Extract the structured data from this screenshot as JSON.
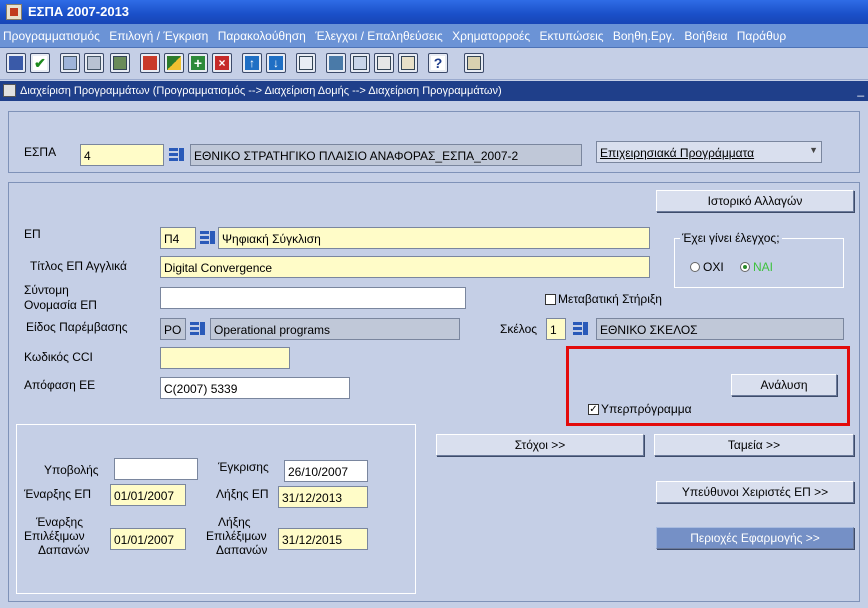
{
  "window": {
    "title": "ΕΣΠΑ 2007-2013"
  },
  "menu": [
    "Προγραμματισμός",
    "Επιλογή / Έγκριση",
    "Παρακολούθηση",
    "Έλεγχοι / Επαληθεύσεις",
    "Χρηματορροές",
    "Εκτυπώσεις",
    "Βοηθη.Εργ.",
    "Βοήθεια",
    "Παράθυρ"
  ],
  "toolbar": {
    "icons": [
      "save-icon",
      "accept-icon",
      "copy-record-icon",
      "clear-record-icon",
      "duplicate-icon",
      "clear-icon",
      "pen-icon",
      "insert-record-icon",
      "delete-record-icon",
      "prev-record-icon",
      "next-record-icon",
      "list-icon",
      "query-icon",
      "enter-query-icon",
      "execute-query-icon",
      "print-icon",
      "help-icon",
      "exit-icon"
    ]
  },
  "subwindow": {
    "title": "Διαχείριση Προγραμμάτων (Προγραμματισμός --> Διαχείριση Δομής --> Διαχείριση Προγραμμάτων)"
  },
  "header": {
    "espa_label": "ΕΣΠΑ",
    "espa_code": "4",
    "espa_name": "ΕΘΝΙΚΟ ΣΤΡΑΤΗΓΙΚΟ ΠΛΑΙΣΙΟ ΑΝΑΦΟΡΑΣ_ΕΣΠΑ_2007-2",
    "program_type_selected": "Επιχειρησιακά Προγράμματα"
  },
  "form": {
    "history_button": "Ιστορικό Αλλαγών",
    "ep_label": "ΕΠ",
    "ep_code": "Π4",
    "ep_name": "Ψηφιακή Σύγκλιση",
    "title_en_label": "Τίτλος ΕΠ Αγγλικά",
    "title_en_value": "Digital Convergence",
    "short_name_label_1": "Σύντομη",
    "short_name_label_2": "Ονομασία ΕΠ",
    "short_name_value": "",
    "checked_group_label": "Έχει γίνει έλεγχος;",
    "radio_no": "ΟΧΙ",
    "radio_yes": "ΝΑΙ",
    "transitional_label": "Μεταβατική Στήριξη",
    "intervention_label": "Είδος Παρέμβασης",
    "intervention_code": "PO",
    "intervention_name": "Operational programs",
    "skelos_label": "Σκέλος",
    "skelos_code": "1",
    "skelos_name": "ΕΘΝΙΚΟ ΣΚΕΛΟΣ",
    "cci_label": "Κωδικός CCI",
    "cci_value": "",
    "decision_label": "Απόφαση ΕΕ",
    "decision_value": "C(2007) 5339",
    "subprogram_label": "Υπερπρόγραμμα",
    "analysis_button": "Ανάλυση",
    "goals_button": "Στόχοι >>",
    "funds_button": "Ταμεία >>",
    "managers_button": "Υπεύθυνοι Χειριστές ΕΠ >>",
    "regions_button": "Περιοχές Εφαρμογής >>"
  },
  "dates": {
    "submission_label": "Υποβολής",
    "submission_value": "",
    "approval_label": "Έγκρισης",
    "approval_value": "26/10/2007",
    "start_label": "Έναρξης ΕΠ",
    "start_value": "01/01/2007",
    "end_label": "Λήξης ΕΠ",
    "end_value": "31/12/2013",
    "elig_start_label_1": "Έναρξης",
    "elig_start_label_2": "Επιλέξιμων",
    "elig_start_label_3": "Δαπανών",
    "elig_start_value": "01/01/2007",
    "elig_end_label_1": "Λήξης",
    "elig_end_label_2": "Επιλέξιμων",
    "elig_end_label_3": "Δαπανών",
    "elig_end_value": "31/12/2015"
  },
  "colors": {
    "highlight": "#e30b0b",
    "title_bar": "#1a4fc8",
    "menu_bar": "#6b93d6",
    "field_yellow": "#fffcc8"
  }
}
